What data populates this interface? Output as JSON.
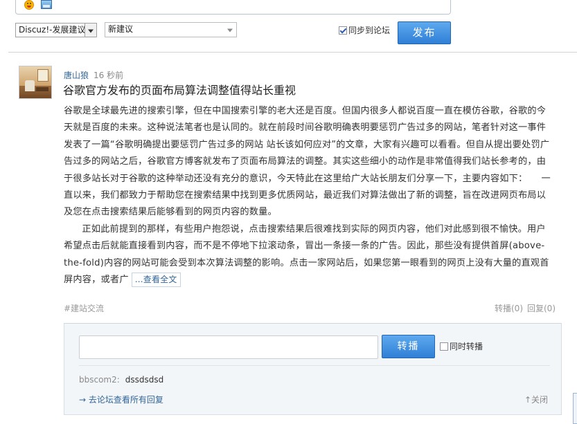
{
  "composer": {
    "forum_select": "Discuz!-发展建议",
    "type_select": "新建议",
    "sync_label": "同步到论坛",
    "sync_checked": true,
    "publish_label": "发布"
  },
  "post": {
    "author": "唐山狼",
    "time": "16 秒前",
    "title": "谷歌官方发布的页面布局算法调整值得站长重视",
    "body_p1": "谷歌是全球最先进的搜索引擎，但在中国搜索引擎的老大还是百度。但国内很多人都说百度一直在模仿谷歌，谷歌的今天就是百度的未来。这种说法笔者也是认同的。就在前段时间谷歌明确表明要惩罚广告过多的网站，笔者针对这一事件发表了一篇“谷歌明确提出要惩罚广告过多的网站 站长该如何应对”的文章，大家有兴趣可以看看。但自从提出要处罚广告过多的网站之后，谷歌官方博客就发布了页面布局算法的调整。其实这些细小的动作是非常值得我们站长参考的，由于很多站长对于谷歌的这种举动还没有充分的意识，今天特此在这里给广大站长朋友们分享一下，主要内容如下：　　一直以来，我们都致力于帮助您在搜索结果中找到更多优质网站，最近我们对算法做出了新的调整，旨在改进网页布局以及您在点击搜索结果后能够看到的网页内容的数量。",
    "body_p2": "正如此前提到的那样，有些用户抱怨说，点击搜索结果后很难找到实际的网页内容，他们对此感到很不愉快。用户希望点击后就能直接看到内容，而不是不停地下拉滚动条，冒出一条接一条的广告。因此，那些没有提供首屏(above-the-fold)内容的网站可能会受到本次算法调整的影响。点击一家网站后，如果您第一眼看到的网页上没有大量的直观首屏内容，或者广",
    "view_full": "...查看全文",
    "tag": "#建站交流",
    "forward_count": "转播(0)",
    "reply_count": "回复(0)"
  },
  "reply_panel": {
    "input_value": "",
    "forward_button": "转播",
    "same_time_label": "同时转播",
    "same_time_checked": false,
    "reply_user": "bbscom2:",
    "reply_text": "dssdsdsd",
    "all_replies_link": "→ 去论坛查看所有回复",
    "close_link": "↑关闭"
  },
  "icons": {
    "emoji": "smiley-emoji-icon",
    "image": "image-insert-icon"
  }
}
